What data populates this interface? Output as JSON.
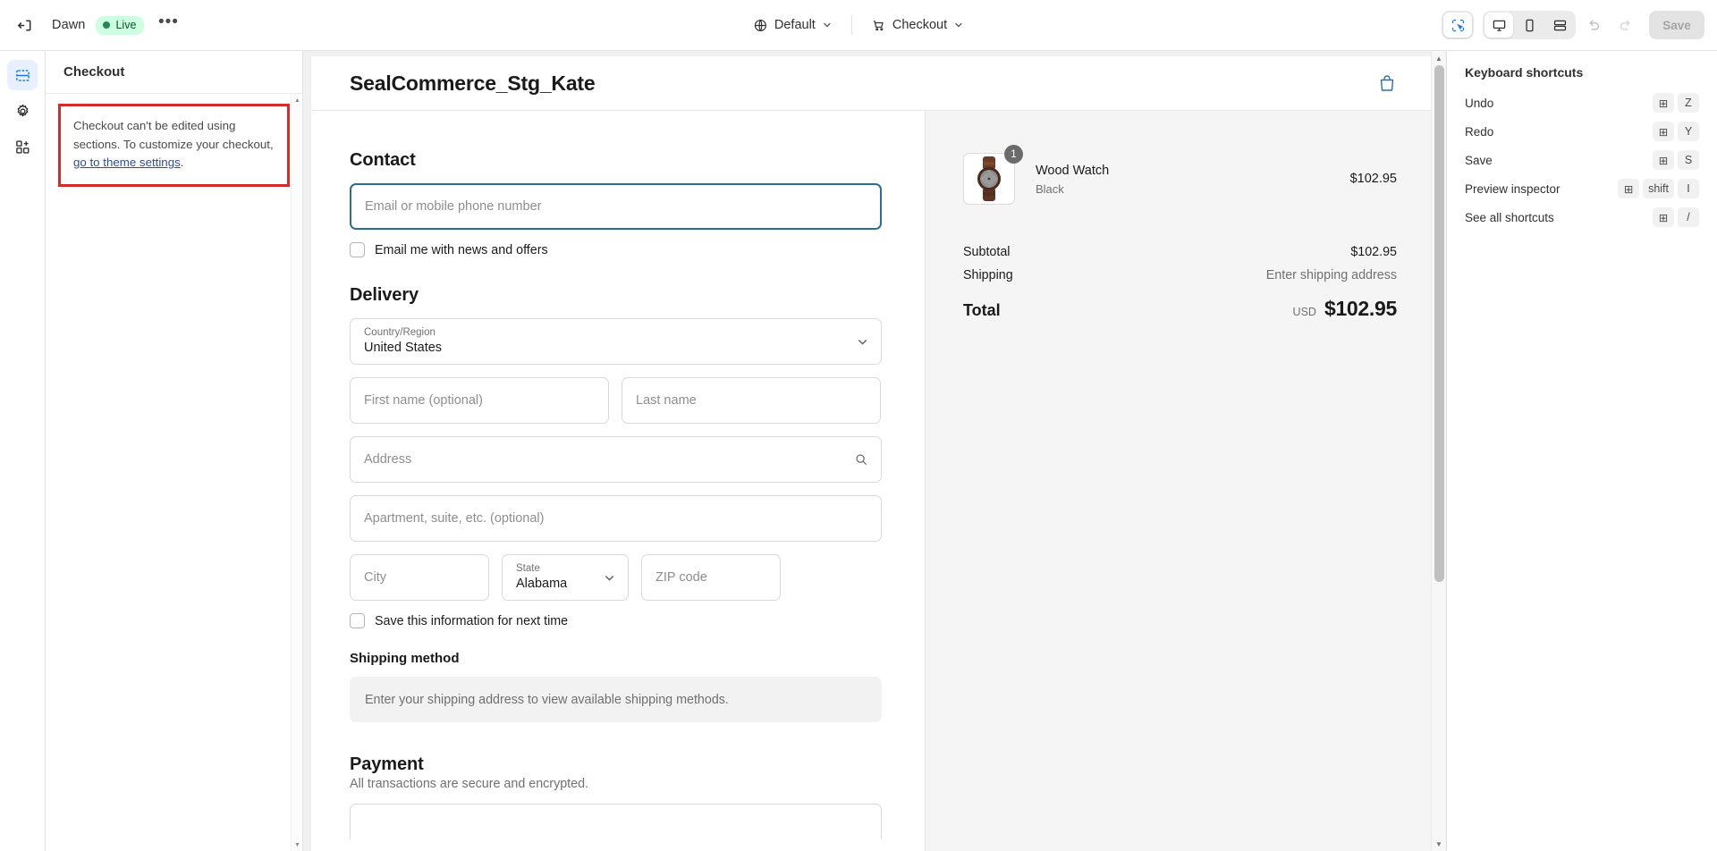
{
  "topbar": {
    "exit_icon": "exit-icon",
    "theme_name": "Dawn",
    "status_badge": "Live",
    "more_label": "•••",
    "locale_label": "Default",
    "locale_icon": "globe-icon",
    "page_label": "Checkout",
    "page_icon": "cart-icon",
    "devices": [
      {
        "name": "inspector-toggle",
        "icon": "selection-cursor-icon",
        "active": true
      },
      {
        "name": "desktop-view",
        "icon": "desktop-icon",
        "active": true
      },
      {
        "name": "mobile-view",
        "icon": "mobile-icon",
        "active": false
      },
      {
        "name": "fullscreen-view",
        "icon": "fullscreen-icon",
        "active": false
      }
    ],
    "undo_icon": "undo-icon",
    "redo_icon": "redo-icon",
    "save_label": "Save"
  },
  "rail": {
    "items": [
      {
        "name": "sections-icon",
        "label": "Sections",
        "active": true
      },
      {
        "name": "gear-icon",
        "label": "Theme settings",
        "active": false
      },
      {
        "name": "app-blocks-icon",
        "label": "App blocks",
        "active": false
      }
    ]
  },
  "left_panel": {
    "header": "Checkout",
    "warning_text_1": "Checkout can't be edited using sections. To customize your checkout, ",
    "warning_link": "go to theme settings",
    "warning_text_2": "."
  },
  "preview": {
    "shop_name": "SealCommerce_Stg_Kate",
    "bag_icon": "shopping-bag-icon",
    "contact": {
      "heading": "Contact",
      "email_placeholder": "Email or mobile phone number",
      "email_value": "",
      "newsletter_label": "Email me with news and offers",
      "newsletter_checked": false
    },
    "delivery": {
      "heading": "Delivery",
      "country_label": "Country/Region",
      "country_value": "United States",
      "first_name_placeholder": "First name (optional)",
      "last_name_placeholder": "Last name",
      "address_placeholder": "Address",
      "address_search_icon": "search-icon",
      "apartment_placeholder": "Apartment, suite, etc. (optional)",
      "city_placeholder": "City",
      "state_label": "State",
      "state_value": "Alabama",
      "zip_placeholder": "ZIP code",
      "save_info_label": "Save this information for next time",
      "save_info_checked": false
    },
    "shipping": {
      "heading": "Shipping method",
      "empty_message": "Enter your shipping address to view available shipping methods."
    },
    "payment": {
      "heading": "Payment",
      "subtitle": "All transactions are secure and encrypted."
    },
    "summary": {
      "line_items": [
        {
          "name": "Wood Watch",
          "variant": "Black",
          "quantity": "1",
          "price": "$102.95"
        }
      ],
      "subtotal_label": "Subtotal",
      "subtotal_value": "$102.95",
      "shipping_label": "Shipping",
      "shipping_value": "Enter shipping address",
      "total_label": "Total",
      "currency": "USD",
      "total_value": "$102.95"
    }
  },
  "right_panel": {
    "title": "Keyboard shortcuts",
    "shortcuts": [
      {
        "label": "Undo",
        "keys": [
          "⊞",
          "Z"
        ]
      },
      {
        "label": "Redo",
        "keys": [
          "⊞",
          "Y"
        ]
      },
      {
        "label": "Save",
        "keys": [
          "⊞",
          "S"
        ]
      },
      {
        "label": "Preview inspector",
        "keys": [
          "⊞",
          "shift",
          "I"
        ]
      },
      {
        "label": "See all shortcuts",
        "keys": [
          "⊞",
          "/"
        ]
      }
    ]
  },
  "colors": {
    "accent_blue": "#1a73e8",
    "warning_border": "#d72b2b",
    "live_bg": "#cdfee1",
    "live_text": "#0c5132",
    "focus_border": "#2c6e8f"
  }
}
